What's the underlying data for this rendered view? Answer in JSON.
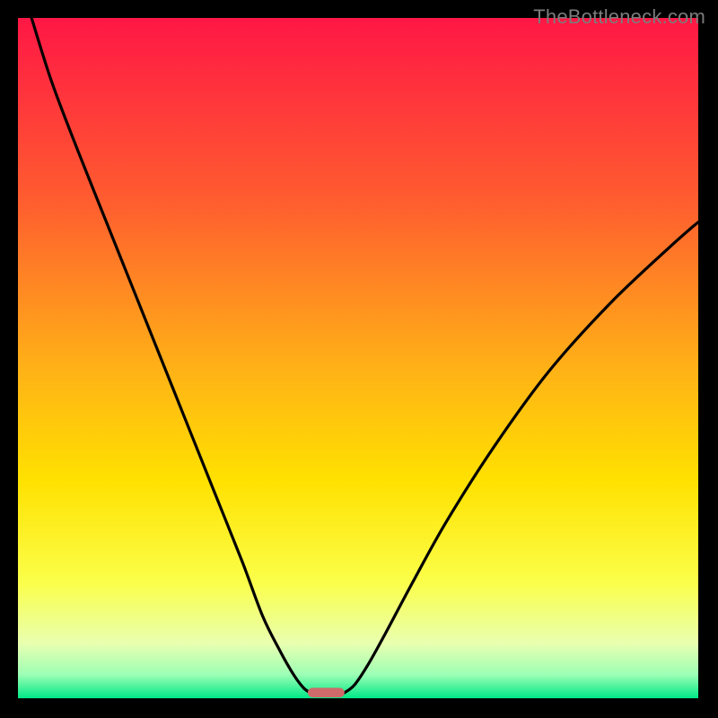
{
  "watermark": "TheBottleneck.com",
  "chart_data": {
    "type": "line",
    "title": "",
    "xlabel": "",
    "ylabel": "",
    "xlim": [
      0,
      100
    ],
    "ylim": [
      0,
      100
    ],
    "grid": false,
    "legend": false,
    "background_gradient": {
      "stops": [
        {
          "offset": 0.0,
          "color": "#ff1745"
        },
        {
          "offset": 0.27,
          "color": "#ff5d2f"
        },
        {
          "offset": 0.52,
          "color": "#ffb316"
        },
        {
          "offset": 0.68,
          "color": "#ffe100"
        },
        {
          "offset": 0.83,
          "color": "#fbff4a"
        },
        {
          "offset": 0.92,
          "color": "#e8ffb0"
        },
        {
          "offset": 0.965,
          "color": "#9dffb5"
        },
        {
          "offset": 1.0,
          "color": "#00e887"
        }
      ]
    },
    "series": [
      {
        "name": "left-curve",
        "x": [
          2,
          5,
          9,
          13,
          17,
          21,
          25,
          29,
          33,
          36,
          38.5,
          40.5,
          42,
          43
        ],
        "y": [
          100,
          90.5,
          80,
          70,
          60,
          50,
          40,
          30,
          20,
          12,
          7,
          3.5,
          1.5,
          0.8
        ]
      },
      {
        "name": "right-curve",
        "x": [
          48,
          49.5,
          51.5,
          54,
          58,
          63,
          70,
          78,
          87,
          96,
          100
        ],
        "y": [
          0.8,
          2,
          5,
          9.5,
          17,
          26,
          37,
          48,
          58,
          66.5,
          70
        ]
      }
    ],
    "marker": {
      "name": "bottleneck-marker",
      "x_center": 45.3,
      "width": 5.4,
      "height": 1.4,
      "color": "#cf6a6a"
    }
  }
}
